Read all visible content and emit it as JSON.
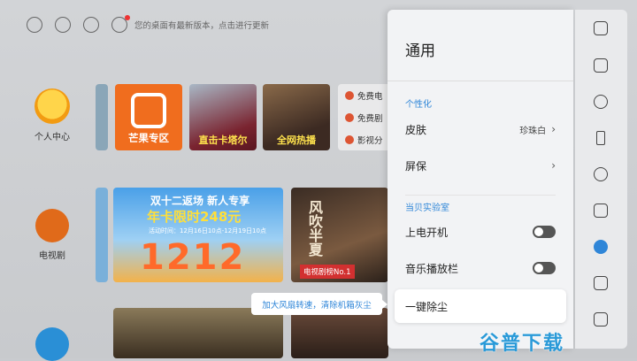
{
  "topbar": {
    "update_text": "您的桌面有最新版本，点击进行更新"
  },
  "left_nav": {
    "personal_center": "个人中心",
    "tv_series": "电视剧"
  },
  "cards": {
    "mango_caption": "芒果专区",
    "qatar_caption": "直击卡塔尔",
    "hot_caption": "全网热播",
    "mini_list": [
      "免费电",
      "免费剧",
      "影视分"
    ],
    "promo_line1": "双十二返场 新人专享",
    "promo_line2": "年卡限时248元",
    "promo_line3": "活动时间：12月16日10点-12月19日10点",
    "promo_big": "1212",
    "drama_tag": "电视剧榜No.1",
    "drama_title": "风吹半夏"
  },
  "settings": {
    "title": "通用",
    "section_personalize": "个性化",
    "skin_label": "皮肤",
    "skin_value": "珍珠白",
    "screensaver_label": "屏保",
    "section_lab": "当贝实验室",
    "power_on_label": "上电开机",
    "power_on_enabled": false,
    "music_bar_label": "音乐播放栏",
    "music_bar_enabled": false,
    "dust_label": "一键除尘",
    "dust_tooltip": "加大风扇转速，清除机箱灰尘",
    "chevron": "›"
  },
  "rail_icons": [
    "display-icon",
    "picture-icon",
    "planet-icon",
    "bluetooth-icon",
    "bell-icon",
    "input-icon",
    "smile-icon",
    "apps-icon",
    "info-icon"
  ],
  "watermark": "谷普下载",
  "colors": {
    "accent": "#2f86d8"
  }
}
